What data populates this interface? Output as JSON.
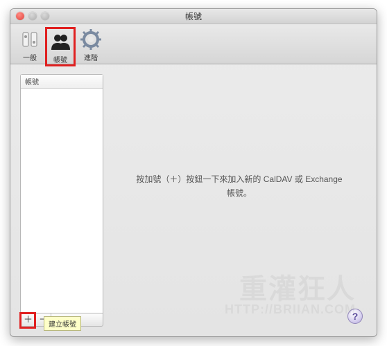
{
  "window": {
    "title": "帳號"
  },
  "toolbar": {
    "general": "一般",
    "accounts": "帳號",
    "advanced": "進階"
  },
  "sidebar": {
    "header": "帳號",
    "add_symbol": "＋",
    "remove_symbol": "－"
  },
  "detail": {
    "message_line1": "按加號（＋）按鈕一下來加入新的 CalDAV 或 Exchange",
    "message_line2": "帳號。"
  },
  "help": {
    "label": "?"
  },
  "tooltip": {
    "text": "建立帳號"
  },
  "watermark": {
    "line1": "重灌狂人",
    "line2": "HTTP://BRIIAN.COM"
  }
}
